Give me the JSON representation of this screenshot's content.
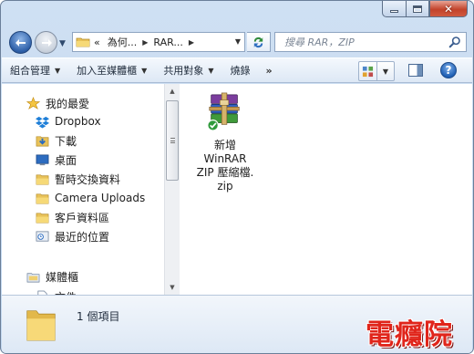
{
  "window": {
    "caption_buttons": {
      "minimize": "",
      "maximize": "",
      "close": "✕"
    }
  },
  "address": {
    "overflow": "«",
    "segments": [
      "為何...",
      "RAR..."
    ]
  },
  "search": {
    "placeholder": "搜尋 RAR，ZIP"
  },
  "toolbar": {
    "items": [
      "組合管理",
      "加入至媒體櫃",
      "共用對象",
      "燒錄"
    ],
    "more": "»",
    "help": "?"
  },
  "nav": {
    "favorites_header": "我的最愛",
    "favorites": [
      "Dropbox",
      "下載",
      "桌面",
      "暫時交換資料",
      "Camera Uploads",
      "客戶資料區",
      "最近的位置"
    ],
    "libraries_header": "媒體櫃",
    "libraries": [
      "文件"
    ]
  },
  "files": [
    {
      "label": "新增\nWinRAR\nZIP 壓縮檔.\nzip",
      "icon": "winrar-archive-icon"
    }
  ],
  "details": {
    "count": "1 個項目"
  },
  "watermark": "電癮院",
  "colors": {
    "accent": "#2d5fa8",
    "close": "#c2432b",
    "watermark": "#e0251b"
  }
}
